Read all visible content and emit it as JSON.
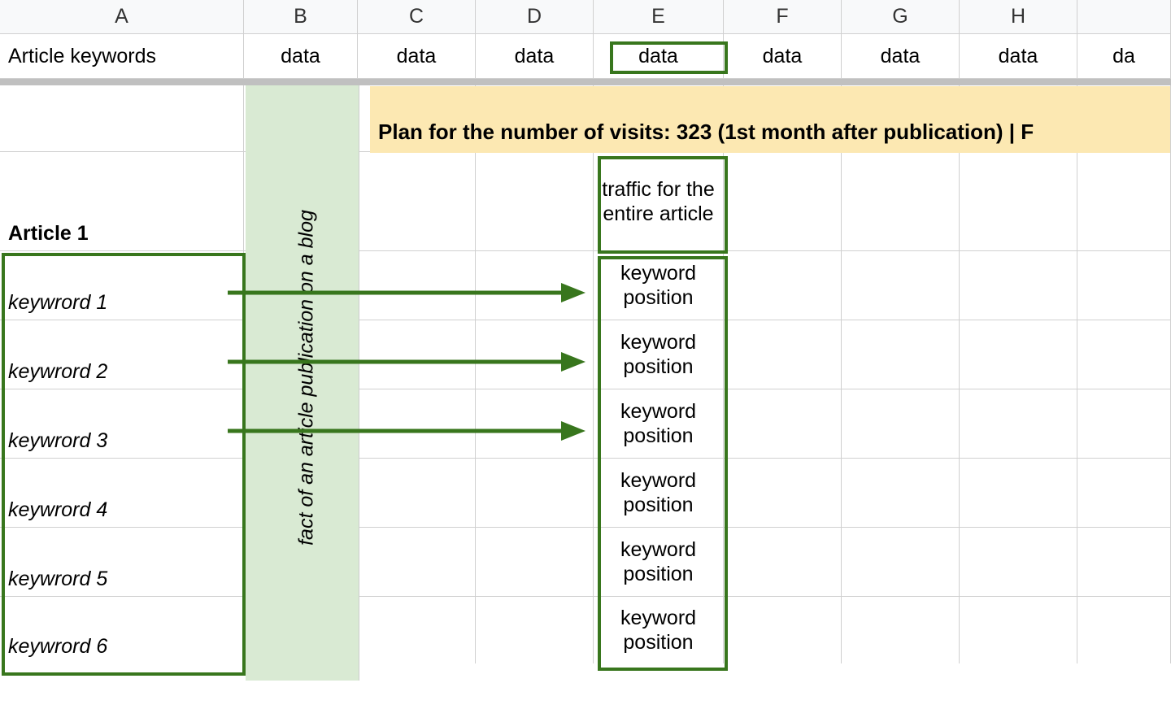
{
  "columns": {
    "A": "A",
    "B": "B",
    "C": "C",
    "D": "D",
    "E": "E",
    "F": "F",
    "G": "G",
    "H": "H"
  },
  "header_row": {
    "A": "Article keywords",
    "B": "data",
    "C": "data",
    "D": "data",
    "E": "data",
    "F": "data",
    "G": "data",
    "H": "data",
    "I_partial": "da"
  },
  "green_column_label": "fact of an article publication on a blog",
  "plan_text": "Plan for the number of visits: 323 (1st month after publication) | F",
  "article_title": "Article 1",
  "keywords": [
    "keywrord 1",
    "keywrord 2",
    "keywrord 3",
    "keywrord 4",
    "keywrord 5",
    "keywrord 6"
  ],
  "traffic_label": "traffic for the entire article",
  "position_label": "keyword position"
}
